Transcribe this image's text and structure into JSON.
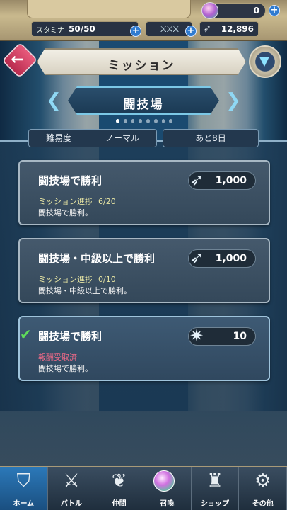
{
  "status": {
    "orbs": "0",
    "stamina_label": "スタミナ",
    "stamina_value": "50/50",
    "duel_swords": "⚔⚔⚔",
    "feathers": "12,896"
  },
  "header": {
    "title": "ミッション",
    "category": "闘技場",
    "page_index": 1,
    "page_count": 8
  },
  "filters": {
    "difficulty_label": "難易度",
    "difficulty_value": "ノーマル",
    "remaining": "あと8日"
  },
  "missions": [
    {
      "name": "闘技場で勝利",
      "progress_label": "ミッション進捗",
      "progress": "6/20",
      "description": "闘技場で勝利。",
      "reward_icon": "feather-icon",
      "reward": "1,000",
      "completed": false
    },
    {
      "name": "闘技場・中級以上で勝利",
      "progress_label": "ミッション進捗",
      "progress": "0/10",
      "description": "闘技場・中級以上で勝利。",
      "reward_icon": "feather-icon",
      "reward": "1,000",
      "completed": false
    },
    {
      "name": "闘技場で勝利",
      "status": "報酬受取済",
      "description": "闘技場で勝利。",
      "reward_icon": "star-fragment-icon",
      "reward": "10",
      "completed": true
    }
  ],
  "nav": [
    {
      "label": "ホーム",
      "icon": "home-icon",
      "active": true
    },
    {
      "label": "バトル",
      "icon": "battle-icon",
      "active": false
    },
    {
      "label": "仲間",
      "icon": "allies-icon",
      "active": false
    },
    {
      "label": "召喚",
      "icon": "summon-icon",
      "active": false
    },
    {
      "label": "ショップ",
      "icon": "shop-icon",
      "active": false
    },
    {
      "label": "その他",
      "icon": "misc-icon",
      "active": false
    }
  ]
}
